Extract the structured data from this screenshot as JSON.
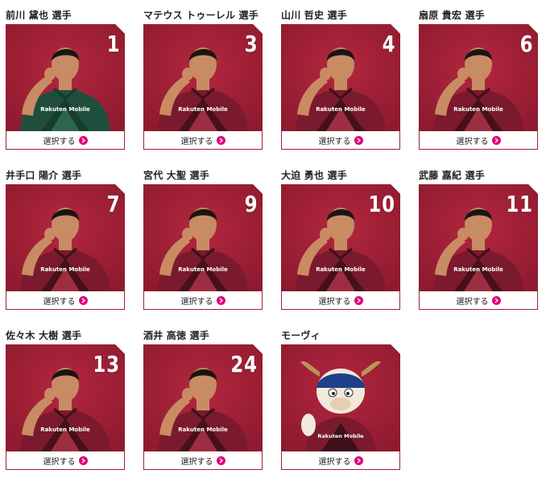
{
  "select_label": "選択する",
  "colors": {
    "accent": "#a21f37",
    "arrow": "#e2007a",
    "kit_green": "#1f4f3c"
  },
  "players": [
    {
      "name": "前川 黛也 選手",
      "number": "1",
      "kit": "green",
      "icon": "player-photo"
    },
    {
      "name": "マテウス トゥーレル 選手",
      "number": "3",
      "kit": "red",
      "icon": "player-photo"
    },
    {
      "name": "山川 哲史 選手",
      "number": "4",
      "kit": "red",
      "icon": "player-photo"
    },
    {
      "name": "扇原 貴宏 選手",
      "number": "6",
      "kit": "red",
      "icon": "player-photo"
    },
    {
      "name": "井手口 陽介 選手",
      "number": "7",
      "kit": "red",
      "icon": "player-photo"
    },
    {
      "name": "宮代 大聖 選手",
      "number": "9",
      "kit": "red",
      "icon": "player-photo"
    },
    {
      "name": "大迫 勇也 選手",
      "number": "10",
      "kit": "red",
      "icon": "player-photo"
    },
    {
      "name": "武藤 嘉紀 選手",
      "number": "11",
      "kit": "red",
      "icon": "player-photo"
    },
    {
      "name": "佐々木 大樹 選手",
      "number": "13",
      "kit": "red",
      "icon": "player-photo"
    },
    {
      "name": "酒井 高徳 選手",
      "number": "24",
      "kit": "red",
      "icon": "player-photo"
    },
    {
      "name": "モーヴィ",
      "number": "",
      "kit": "mascot",
      "icon": "mascot-photo"
    }
  ]
}
